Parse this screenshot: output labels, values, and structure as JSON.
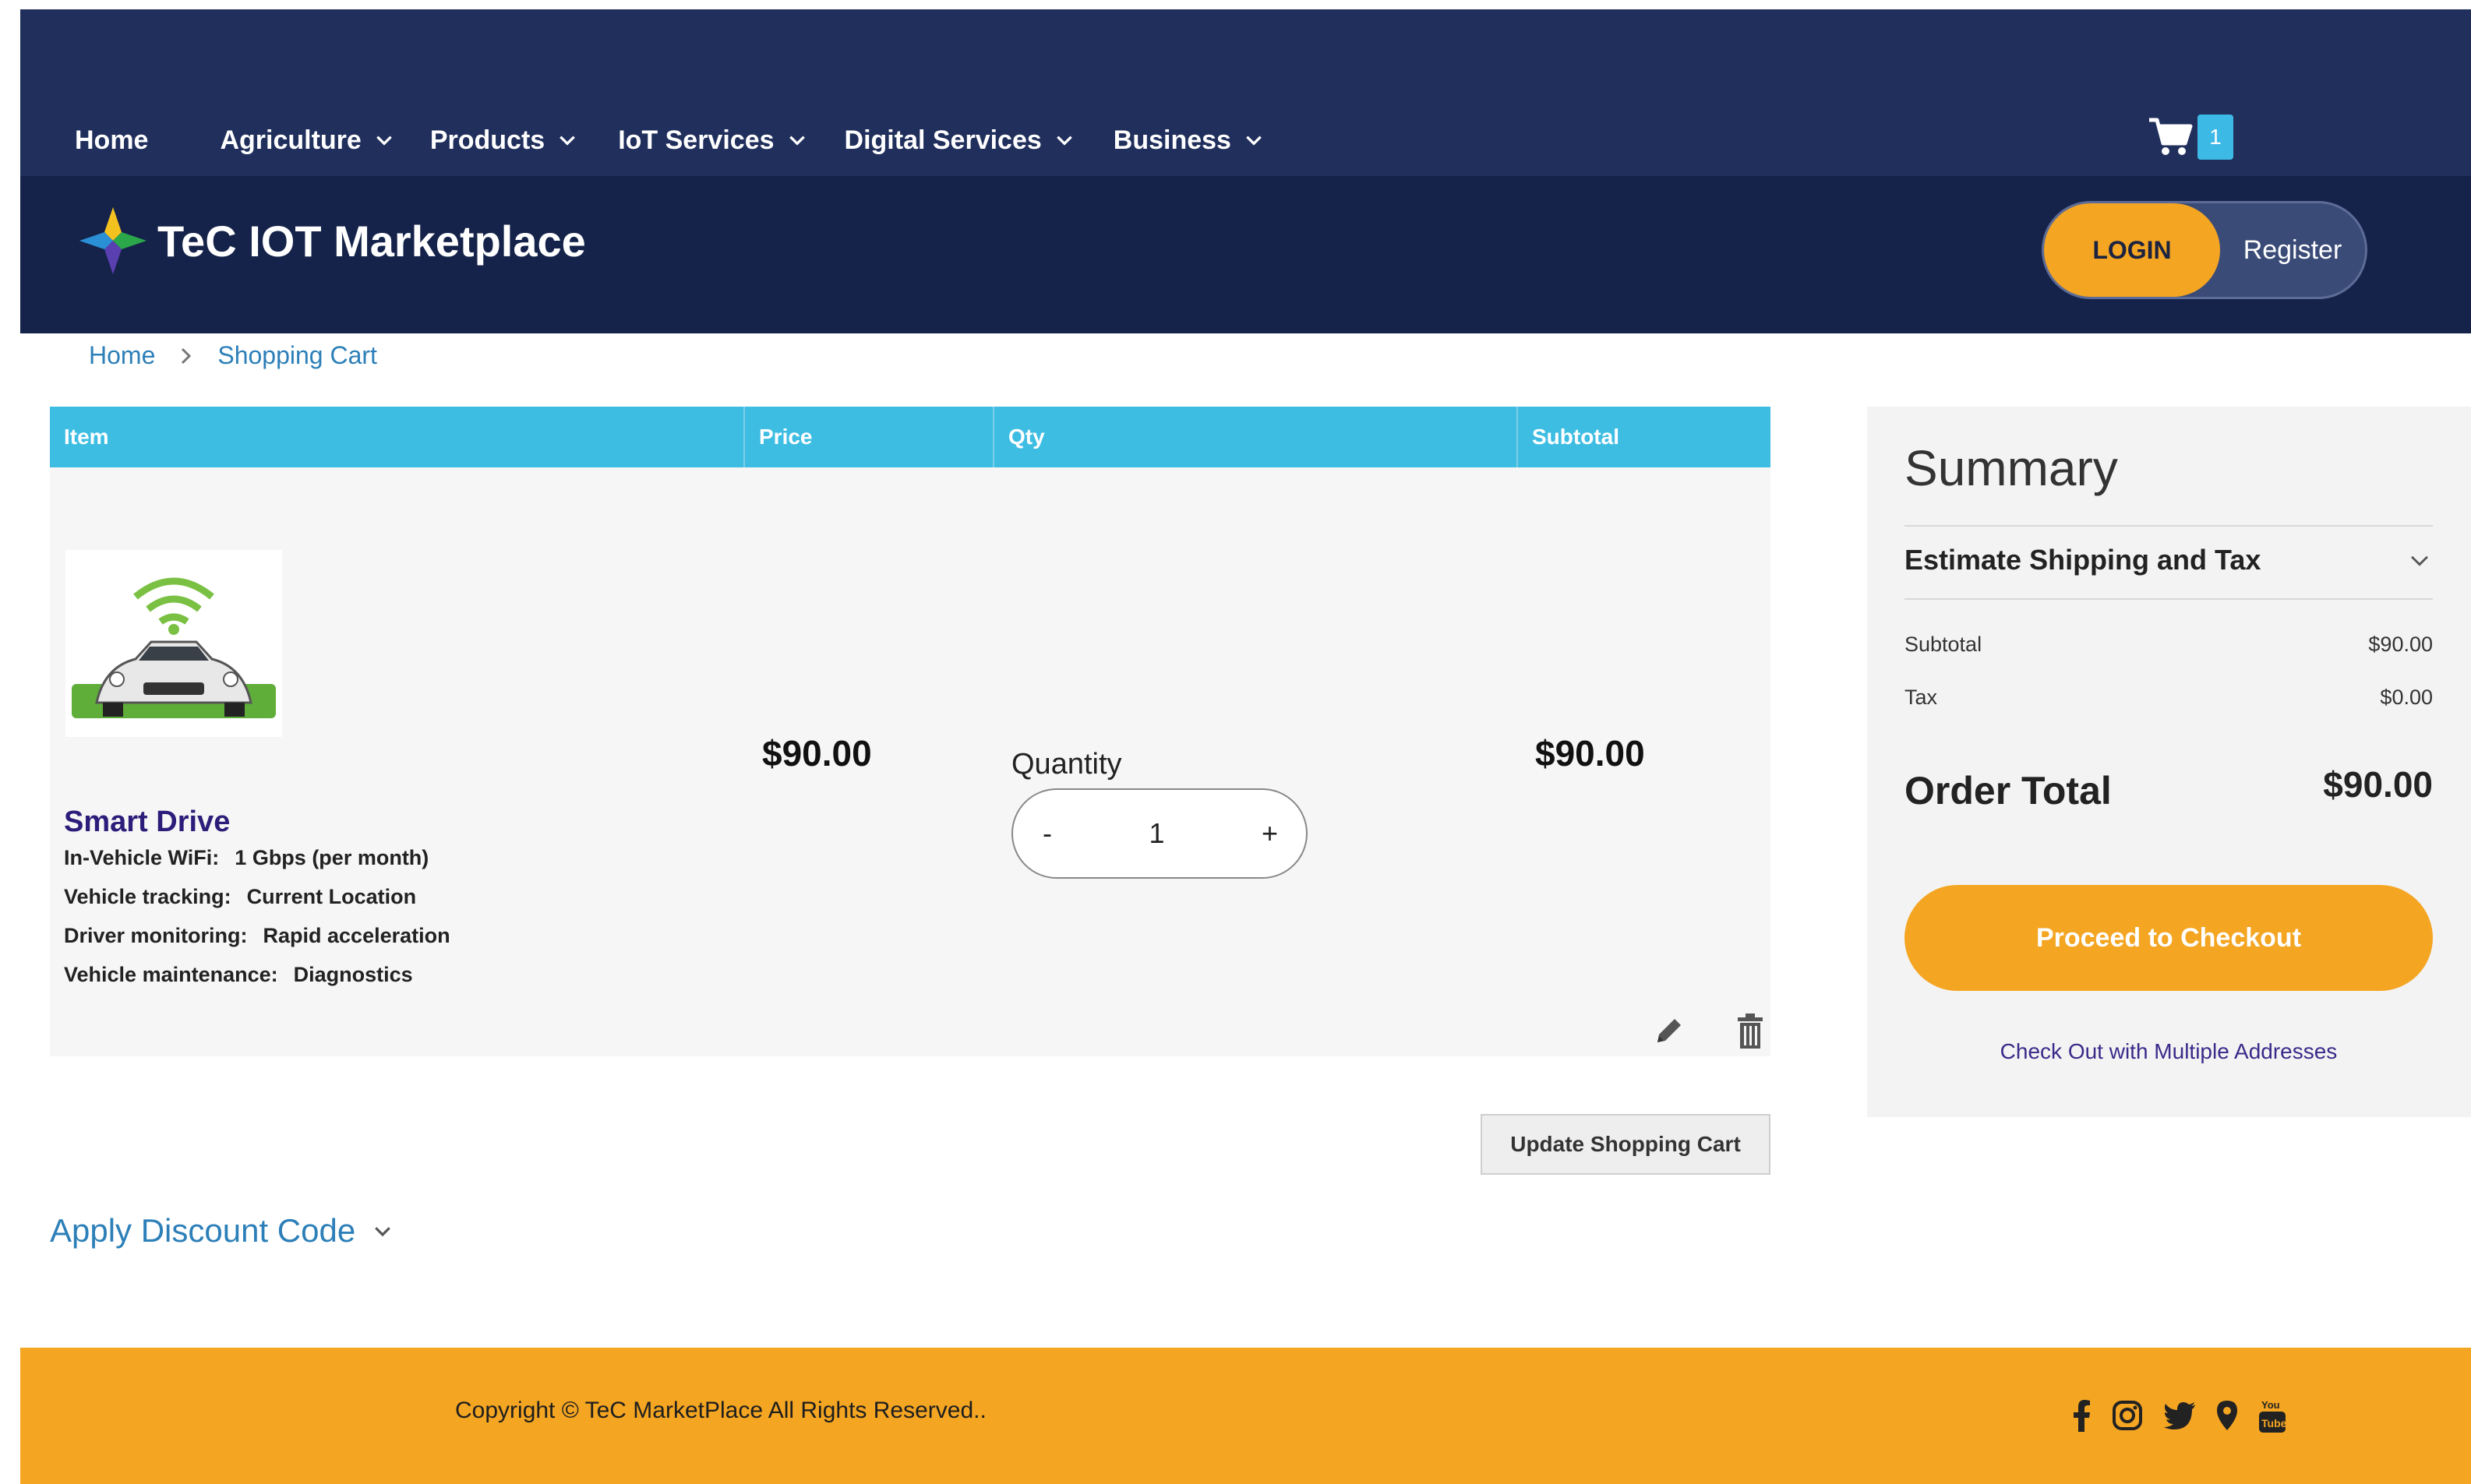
{
  "nav": {
    "items": [
      {
        "label": "Home",
        "has_dropdown": false
      },
      {
        "label": "Agriculture",
        "has_dropdown": true
      },
      {
        "label": "Products",
        "has_dropdown": true
      },
      {
        "label": "IoT Services",
        "has_dropdown": true
      },
      {
        "label": "Digital Services",
        "has_dropdown": true
      },
      {
        "label": "Business",
        "has_dropdown": true
      }
    ],
    "cart_count": "1"
  },
  "brand": {
    "name": "TeC IOT Marketplace",
    "login_label": "LOGIN",
    "register_label": "Register"
  },
  "breadcrumb": {
    "home": "Home",
    "current": "Shopping Cart"
  },
  "cart": {
    "headers": {
      "item": "Item",
      "price": "Price",
      "qty": "Qty",
      "subtotal": "Subtotal"
    },
    "item": {
      "name": "Smart Drive",
      "options": [
        {
          "label": "In-Vehicle WiFi:",
          "value": "1 Gbps (per month)"
        },
        {
          "label": "Vehicle tracking:",
          "value": "Current Location"
        },
        {
          "label": "Driver monitoring:",
          "value": "Rapid acceleration"
        },
        {
          "label": "Vehicle maintenance:",
          "value": "Diagnostics"
        }
      ],
      "price": "$90.00",
      "quantity_label": "Quantity",
      "quantity": "1",
      "decrement": "-",
      "increment": "+",
      "subtotal": "$90.00"
    },
    "update_label": "Update Shopping Cart",
    "discount_label": "Apply Discount Code"
  },
  "summary": {
    "title": "Summary",
    "estimate_label": "Estimate Shipping and Tax",
    "subtotal_label": "Subtotal",
    "subtotal_value": "$90.00",
    "tax_label": "Tax",
    "tax_value": "$0.00",
    "order_total_label": "Order Total",
    "order_total_value": "$90.00",
    "checkout_label": "Proceed to Checkout",
    "multi_address_label": "Check Out with Multiple Addresses"
  },
  "footer": {
    "copyright": "Copyright © TeC MarketPlace All Rights Reserved..",
    "social_icons": [
      "facebook-icon",
      "instagram-icon",
      "twitter-icon",
      "location-icon",
      "youtube-icon"
    ]
  },
  "colors": {
    "nav_bg": "#202f5c",
    "brand_bg": "#15234a",
    "accent": "#f4a522",
    "table_header": "#3ebde3",
    "link": "#2c7fb8",
    "product_name": "#2c1d7a"
  }
}
